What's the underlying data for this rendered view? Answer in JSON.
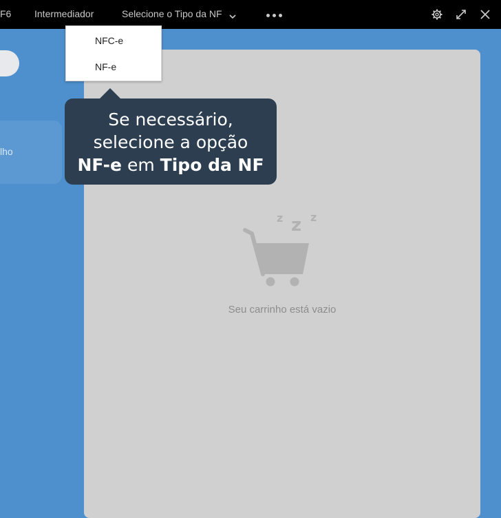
{
  "topbar": {
    "shortcut": "F6",
    "intermediary": "Intermediador",
    "nf_type_select": "Selecione o Tipo da NF",
    "icons": [
      "chevron-down-icon",
      "more-icon",
      "gear-icon",
      "expand-icon",
      "close-icon"
    ]
  },
  "dropdown": {
    "options": [
      "NFC-e",
      "NF-e"
    ]
  },
  "tooltip": {
    "line1": "Se necessário,",
    "line2": "selecione a opção",
    "bold1": "NF-e",
    "mid": " em ",
    "bold2": "Tipo da NF"
  },
  "left": {
    "card_label": "lho"
  },
  "cart": {
    "empty_text": "Seu carrinho está vazio"
  },
  "colors": {
    "background": "#4e8fcd",
    "topbar": "#000000",
    "panel": "#d0d0d0",
    "tooltip": "#2c3e50"
  }
}
